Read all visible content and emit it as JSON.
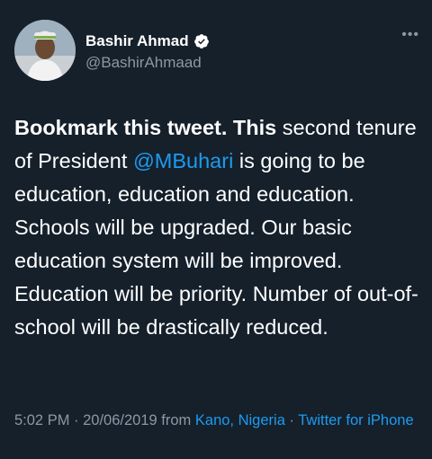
{
  "tweet": {
    "author_name": "Bashir Ahmad",
    "author_handle": "@BashirAhmaad",
    "more_icon": "more-horizontal-icon",
    "text": {
      "bold_1": "Bookmark this tweet.",
      "bold_2": "This",
      "part_1": " second tenure of President ",
      "mention": "@MBuhari",
      "part_2": " is going to be education, education and education. Schools will be upgraded. Our basic education system will be improved. Education will be priority. Number of out-of-school will be drastically reduced."
    },
    "meta": {
      "time": "5:02 PM",
      "sep1": " · ",
      "date": "20/06/2019",
      "from_label": " from ",
      "location": "Kano, Nigeria",
      "sep2": " · ",
      "source": "Twitter for iPhone"
    }
  },
  "colors": {
    "background": "#15202b",
    "text": "#ffffff",
    "secondary": "#8b98a5",
    "accent": "#1d9bf0"
  }
}
